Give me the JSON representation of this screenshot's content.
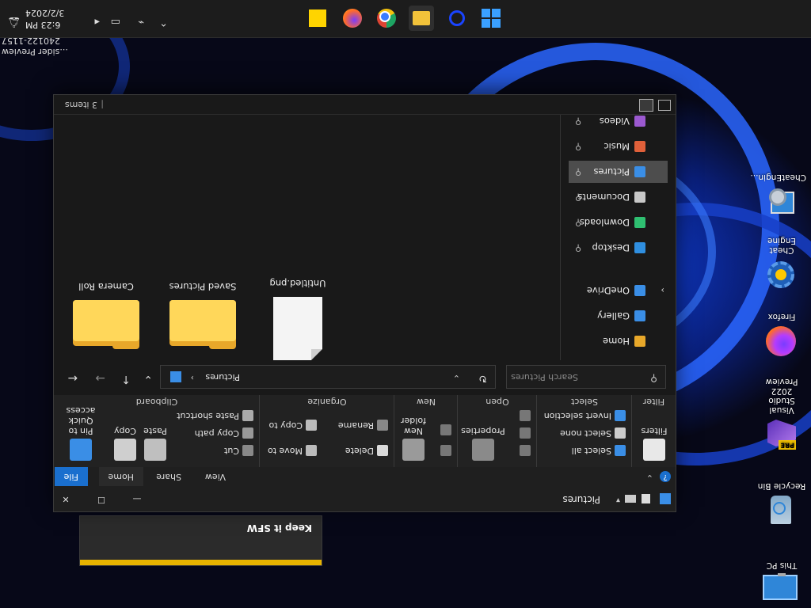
{
  "desktop": {
    "icons": [
      {
        "label": "This PC",
        "icon": "this-pc-icon"
      },
      {
        "label": "Recycle Bin",
        "icon": "recycle-bin-icon"
      },
      {
        "label": "Visual Studio 2022 Preview",
        "icon": "visual-studio-icon"
      },
      {
        "label": "Firefox",
        "icon": "firefox-icon"
      },
      {
        "label": "Cheat Engine",
        "icon": "cheat-engine-icon"
      },
      {
        "label": "CheatEngin...",
        "icon": "cheat-engine-installer-icon"
      }
    ],
    "corner_text": [
      "...sider Preview",
      "240122-1157"
    ],
    "notification": {
      "title": "Keep it SFW",
      "accent": "#e8b400"
    }
  },
  "taskbar": {
    "apps": [
      {
        "name": "start-icon",
        "color": "#3aa0ff"
      },
      {
        "name": "search-icon",
        "color": "#1a44ff"
      },
      {
        "name": "file-explorer-icon",
        "color": "#f2c23a"
      },
      {
        "name": "chrome-icon",
        "color": "#dd4433"
      },
      {
        "name": "firefox-icon",
        "color": "#ff7a1a"
      },
      {
        "name": "sticky-notes-icon",
        "color": "#ffd400"
      }
    ],
    "time": "6:23 PM",
    "date": "3/2/2024"
  },
  "window": {
    "title": "Pictures",
    "tabs": [
      "File",
      "Home",
      "Share",
      "View"
    ],
    "ribbon": {
      "clipboard": {
        "label": "Clipboard",
        "pin_label": "Pin to Quick access",
        "copy_label": "Copy",
        "paste_label": "Paste",
        "cut_label": "Cut",
        "copy_path_label": "Copy path",
        "paste_shortcut_label": "Paste shortcut"
      },
      "organize": {
        "label": "Organize",
        "move_to_label": "Move to",
        "copy_to_label": "Copy to",
        "delete_label": "Delete",
        "rename_label": "Rename"
      },
      "new": {
        "label": "New",
        "new_folder_label": "New folder"
      },
      "open": {
        "label": "Open",
        "properties_label": "Properties"
      },
      "select": {
        "label": "Select",
        "select_all_label": "Select all",
        "select_none_label": "Select none",
        "invert_label": "Invert selection"
      },
      "filter": {
        "label": "Filter",
        "filters_label": "Filters"
      }
    },
    "address": {
      "path": "Pictures",
      "search_placeholder": "Search Pictures"
    },
    "nav": {
      "items": [
        {
          "label": "Home",
          "icon": "home-icon",
          "color": "#e8a82a"
        },
        {
          "label": "Gallery",
          "icon": "gallery-icon",
          "color": "#3a8ee6"
        },
        {
          "label": "OneDrive",
          "icon": "onedrive-icon",
          "color": "#3a8ee6"
        },
        {
          "label": "Desktop",
          "icon": "desktop-icon",
          "color": "#2f8fe0"
        },
        {
          "label": "Downloads",
          "icon": "downloads-icon",
          "color": "#2fbf71"
        },
        {
          "label": "Documents",
          "icon": "documents-icon",
          "color": "#c8c8c8"
        },
        {
          "label": "Pictures",
          "icon": "pictures-icon",
          "color": "#3a8ee6"
        },
        {
          "label": "Music",
          "icon": "music-icon",
          "color": "#e0603a"
        },
        {
          "label": "Videos",
          "icon": "videos-icon",
          "color": "#9b59d0"
        }
      ]
    },
    "files": [
      {
        "name": "Camera Roll",
        "type": "folder"
      },
      {
        "name": "Saved Pictures",
        "type": "folder"
      },
      {
        "name": "Untitled.png",
        "type": "image"
      }
    ],
    "status": {
      "count": "3 items"
    }
  }
}
